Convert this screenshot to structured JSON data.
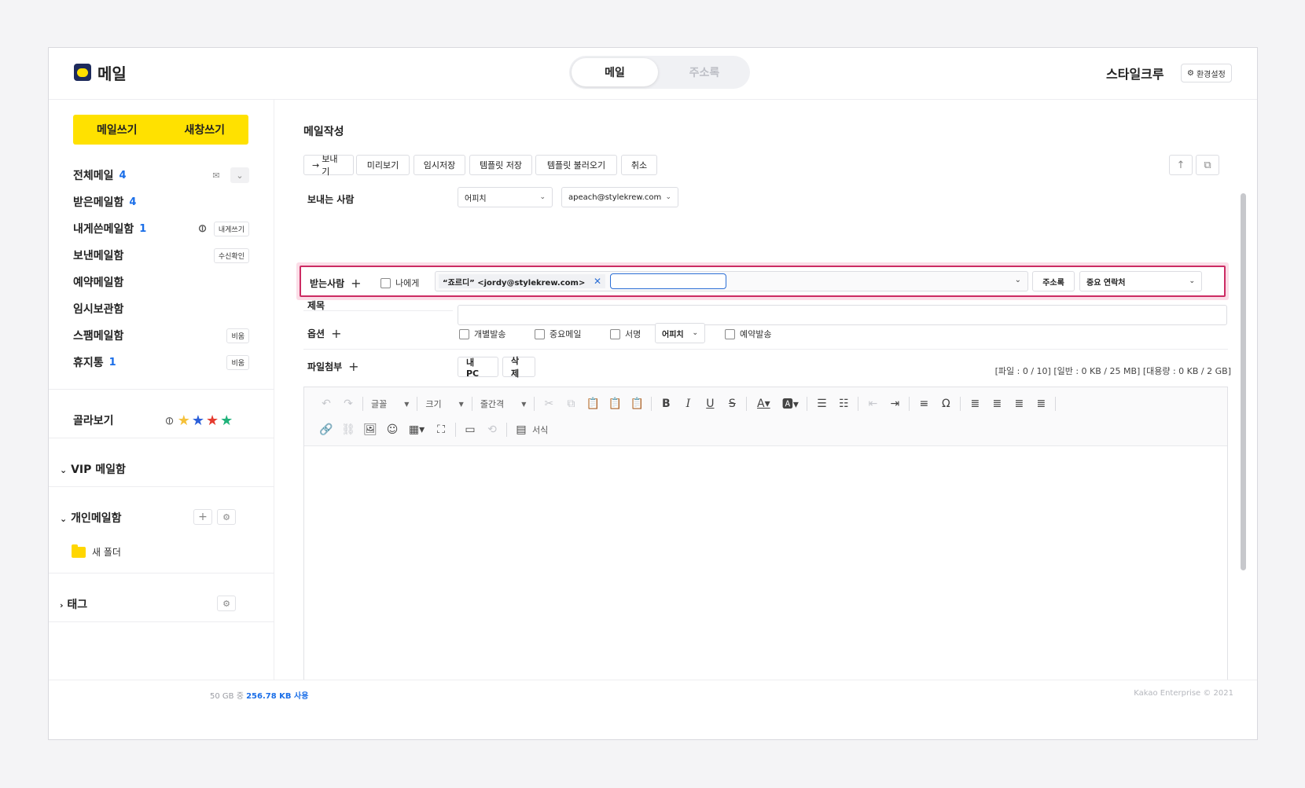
{
  "header": {
    "app_title": "메일",
    "tabs": [
      {
        "label": "메일"
      },
      {
        "label": "주소록"
      }
    ],
    "org_name": "스타일크루",
    "settings_label": "환경설정"
  },
  "sidebar": {
    "compose_label": "메일쓰기",
    "new_window_label": "새창쓰기",
    "folders": [
      {
        "label": "전체메일",
        "count": "4"
      },
      {
        "label": "받은메일함",
        "count": "4"
      },
      {
        "label": "내게쓴메일함",
        "count": "1",
        "action": "내게쓰기"
      },
      {
        "label": "보낸메일함",
        "action": "수신확인"
      },
      {
        "label": "예약메일함"
      },
      {
        "label": "임시보관함"
      },
      {
        "label": "스팸메일함",
        "action": "비움"
      },
      {
        "label": "휴지통",
        "count": "1",
        "action": "비움"
      }
    ],
    "filter_title": "골라보기",
    "vip_title": "VIP 메일함",
    "personal_title": "개인메일함",
    "new_folder": "새 폴더",
    "tag_title": "태그"
  },
  "compose": {
    "title": "메일작성",
    "toolbar": {
      "send": "보내기",
      "preview": "미리보기",
      "save_draft": "임시저장",
      "save_template": "템플릿 저장",
      "load_template": "템플릿 불러오기",
      "cancel": "취소"
    },
    "sender_label": "보내는 사람",
    "sender_name": "어피치",
    "sender_email": "apeach@stylekrew.com",
    "recipient_label": "받는사람",
    "to_me_label": "나에게",
    "recipient_tag": "“죠르디” <jordy@stylekrew.com>",
    "recipient_input_value": "",
    "addressbook_label": "주소록",
    "contact_group": "중요 연락처",
    "subject_label": "제목",
    "subject_value": "",
    "options_label": "옵션",
    "options": {
      "individual": "개별발송",
      "important": "중요메일",
      "signature": "서명",
      "signature_select": "어피치",
      "scheduled": "예약발송"
    },
    "attach_label": "파일첨부",
    "attach_pc": "내 PC",
    "attach_delete": "삭제",
    "attach_info": "[파일 : 0 / 10] [일반 : 0 KB / 25 MB] [대용량 : 0 KB / 2 GB]",
    "editor": {
      "font_label": "글꼴",
      "size_label": "크기",
      "line_height_label": "줄간격",
      "format_label": "서식"
    }
  },
  "footer": {
    "usage_prefix": "50 GB 중",
    "usage_value": "256.78 KB 사용",
    "copyright": "Kakao Enterprise © 2021"
  },
  "colors": {
    "accent_yellow": "#ffe100",
    "link_blue": "#1a6ee8",
    "highlight_pink": "#cc2b63"
  }
}
